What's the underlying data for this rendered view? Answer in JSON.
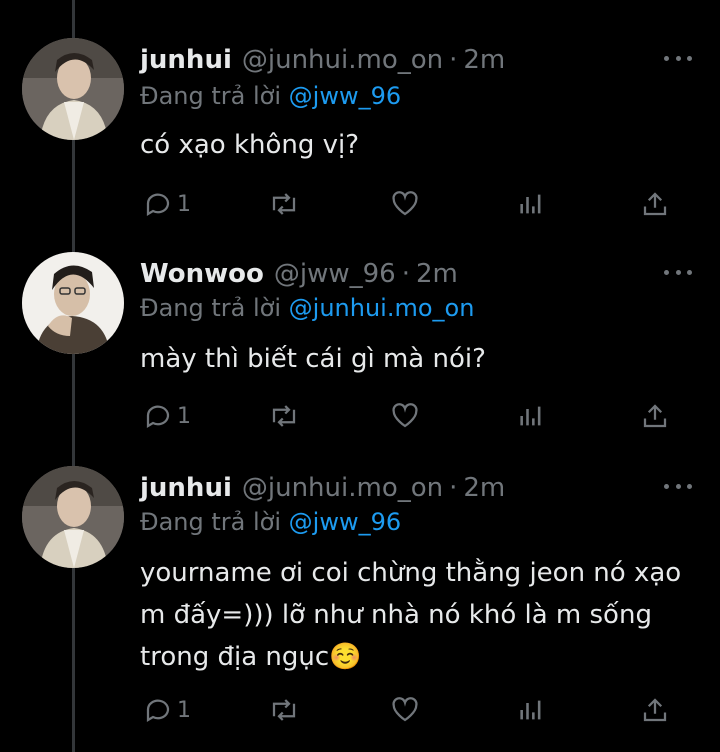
{
  "tweets": [
    {
      "name": "junhui",
      "handle": "@junhui.mo_on",
      "time": "2m",
      "replying_prefix": "Đang trả lời",
      "replying_to": "@jww_96",
      "text": "có xạo không vị?",
      "reply_count": "1"
    },
    {
      "name": "Wonwoo",
      "handle": "@jww_96",
      "time": "2m",
      "replying_prefix": "Đang trả lời",
      "replying_to": "@junhui.mo_on",
      "text": "mày thì biết cái gì mà nói?",
      "reply_count": "1"
    },
    {
      "name": "junhui",
      "handle": "@junhui.mo_on",
      "time": "2m",
      "replying_prefix": "Đang trả lời",
      "replying_to": "@jww_96",
      "text_lines": [
        "yourname ơi coi chừng thằng jeon nó xạo",
        "m đấy=))) lỡ như nhà nó khó là m sống",
        "trong địa ngục☺️"
      ],
      "reply_count": "1"
    }
  ],
  "separator": "·",
  "colors": {
    "background": "#000000",
    "text": "#e7e9ea",
    "muted": "#71767b",
    "accent": "#1d9bf0"
  },
  "icons": [
    "reply-icon",
    "retweet-icon",
    "like-icon",
    "analytics-icon",
    "share-icon",
    "more-icon"
  ]
}
